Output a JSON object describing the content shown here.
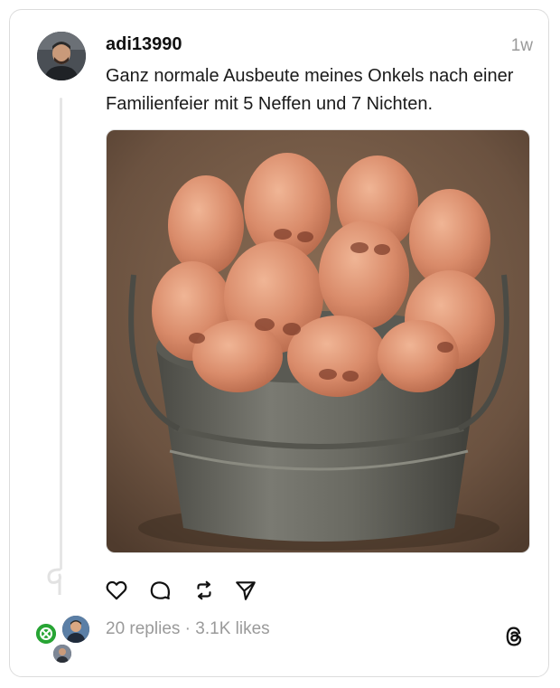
{
  "post": {
    "username": "adi13990",
    "timestamp": "1w",
    "text": "Ganz normale Ausbeute meines Onkels nach einer Familienfeier mit 5 Neffen und 7 Nichten.",
    "image_icon": "bucket-of-noses-photo"
  },
  "actions": {
    "like_icon": "heart-icon",
    "reply_icon": "comment-icon",
    "repost_icon": "repost-icon",
    "share_icon": "send-icon"
  },
  "stats": {
    "replies": "20 replies",
    "separator": "·",
    "likes": "3.1K likes"
  },
  "brand": {
    "logo_icon": "threads-logo-icon"
  },
  "colors": {
    "muted": "#9a9a9a",
    "text": "#111111",
    "border": "#dcdcdc"
  }
}
